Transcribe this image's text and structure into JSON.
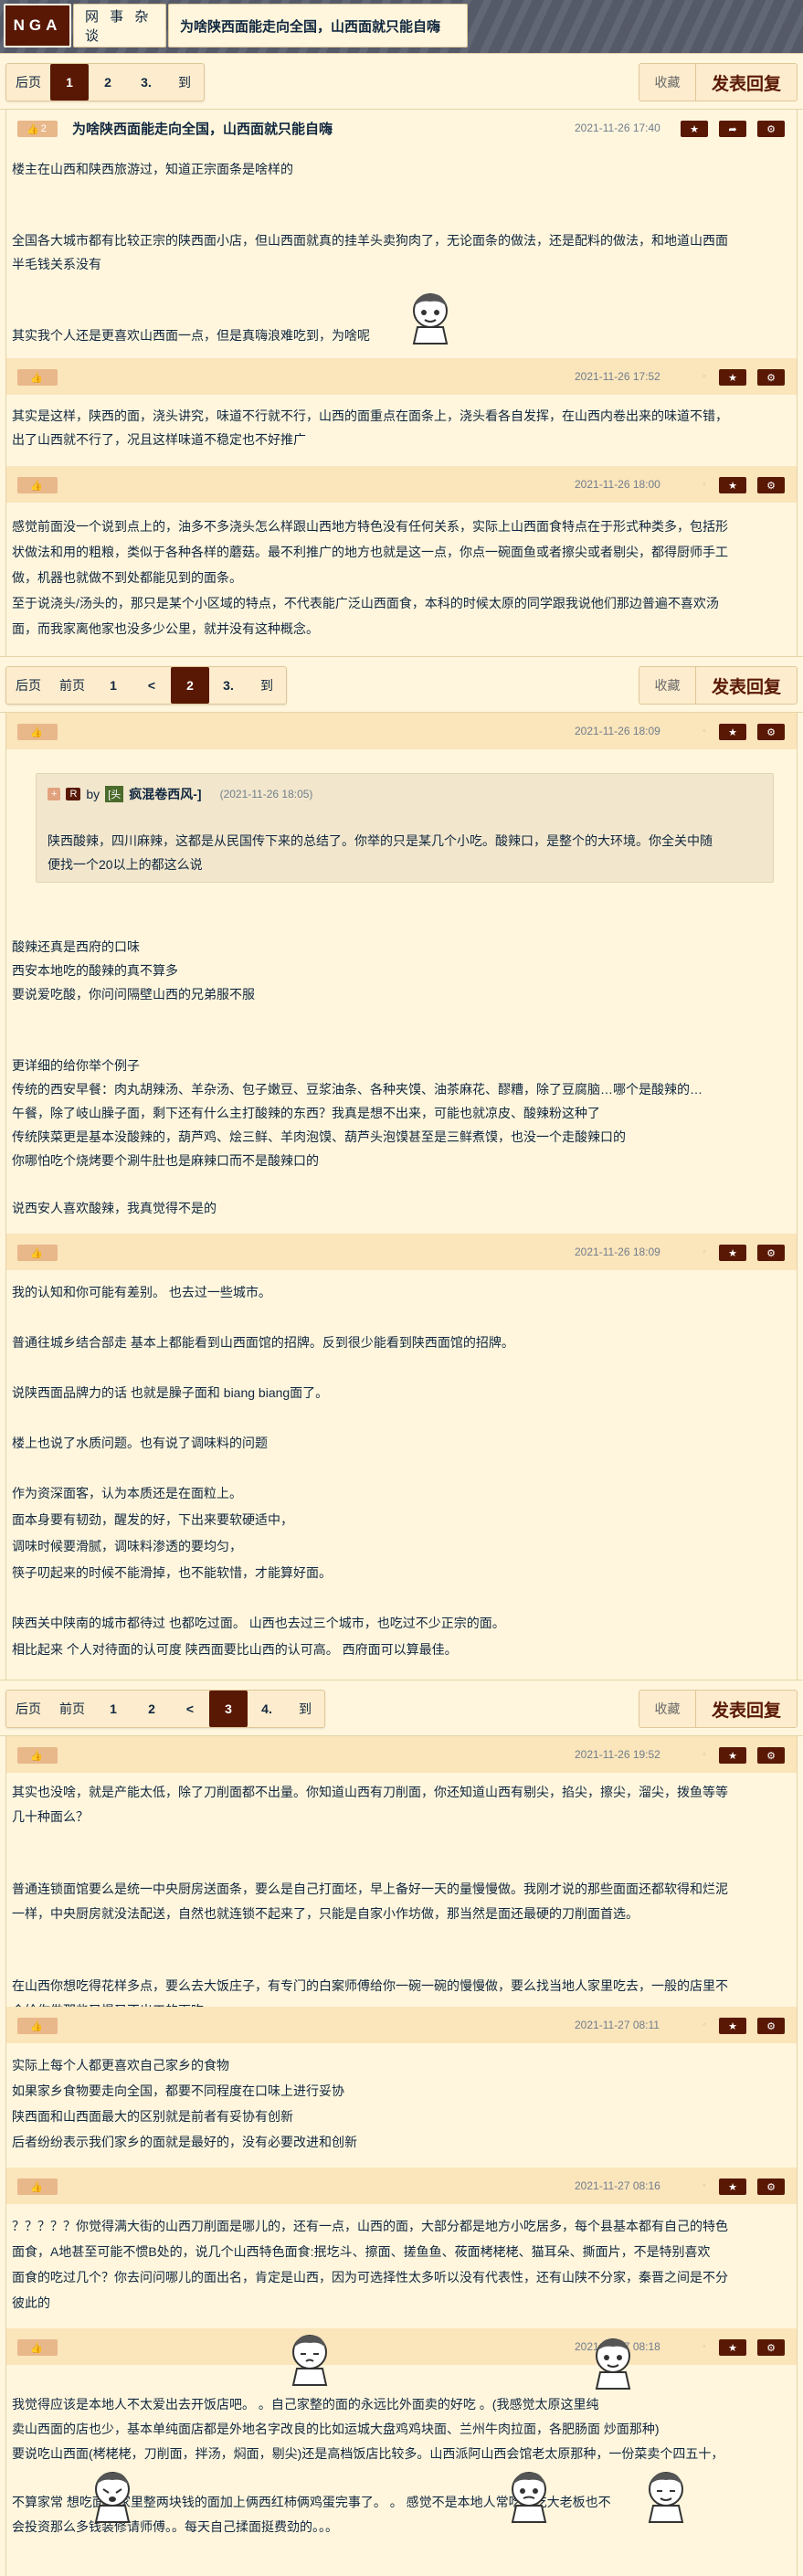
{
  "site": {
    "logo": "NGA",
    "forum": "网 事 杂 谈",
    "thread_title": "为啥陕西面能走向全国，山西面就只能自嗨"
  },
  "colors": {
    "accent": "#591804",
    "background": "#fff6dd",
    "time": "#707d8c"
  },
  "icons": {
    "vote": "thumbs-icon",
    "dot": "lamp-icon",
    "star": "star-icon",
    "share": "share-icon",
    "gear": "gear-icon"
  },
  "pager1": {
    "items": [
      "后页",
      "1",
      "2",
      "3.",
      "到"
    ],
    "current": "1"
  },
  "pager2": {
    "items": [
      "后页",
      "前页",
      "1",
      "<",
      "2",
      "3.",
      "到"
    ],
    "current": "2"
  },
  "pager3": {
    "items": [
      "后页",
      "前页",
      "1",
      "2",
      "<",
      "3",
      "4.",
      "到"
    ],
    "current": "3"
  },
  "actions": {
    "favorite": "收藏",
    "reply": "发表回复"
  },
  "posts": [
    {
      "title": "为啥陕西面能走向全国，山西面就只能自嗨",
      "time": "2021-11-26 17:40",
      "vote": "2",
      "lines": [
        "楼主在山西和陕西旅游过，知道正宗面条是啥样的",
        "",
        "",
        "全国各大城市都有比较正宗的陕西面小店，但山西面就真的挂羊头卖狗肉了，无论面条的做法，还是配料的做法，和地道山西面",
        "半毛钱关系没有",
        "",
        "",
        "其实我个人还是更喜欢山西面一点，但是真嗨浪难吃到，为啥呢"
      ]
    },
    {
      "time": "2021-11-26 17:52",
      "lines": [
        "其实是这样，陕西的面，浇头讲究，味道不行就不行，山西的面重点在面条上，浇头看各自发挥，在山西内卷出来的味道不错，",
        "出了山西就不行了，况且这样味道不稳定也不好推广"
      ]
    },
    {
      "time": "2021-11-26 18:00",
      "lines": [
        "感觉前面没一个说到点上的，油多不多浇头怎么样跟山西地方特色没有任何关系，实际上山西面食特点在于形式种类多，包括形",
        "状做法和用的粗粮，类似于各种各样的蘑菇。最不利推广的地方也就是这一点，你点一碗面鱼或者擦尖或者剔尖，都得厨师手工",
        "做，机器也就做不到处都能见到的面条。",
        "至于说浇头/汤头的，那只是某个小区域的特点，不代表能广泛山西面食，本科的时候太原的同学跟我说他们那边普遍不喜欢汤",
        "面，而我家离他家也没多少公里，就并没有这种概念。"
      ]
    },
    {
      "time": "2021-11-26 18:09",
      "quote": {
        "num": "+",
        "r": "R",
        "by": "by",
        "avatar": "[头",
        "user": "疯混卷西风-]",
        "time": "(2021-11-26 18:05)",
        "lines": [
          "陕西酸辣，四川麻辣，这都是从民国传下来的总结了。你举的只是某几个小吃。酸辣口，是整个的大环境。你全关中随",
          "便找一个20以上的都这么说"
        ]
      },
      "lines": [
        "酸辣还真是西府的口味",
        "西安本地吃的酸辣的真不算多",
        "要说爱吃酸，你问问隔壁山西的兄弟服不服",
        "",
        "",
        "更详细的给你举个例子",
        "传统的西安早餐：肉丸胡辣汤、羊杂汤、包子嫩豆、豆浆油条、各种夹馍、油茶麻花、醪糟，除了豆腐脑…哪个是酸辣的…",
        "午餐，除了岐山臊子面，剩下还有什么主打酸辣的东西？我真是想不出来，可能也就凉皮、酸辣粉这种了",
        "传统陕菜更是基本没酸辣的，葫芦鸡、烩三鲜、羊肉泡馍、葫芦头泡馍甚至是三鲜煮馍，也没一个走酸辣口的",
        "你哪怕吃个烧烤要个涮牛肚也是麻辣口而不是酸辣口的",
        "",
        "说西安人喜欢酸辣，我真觉得不是的"
      ]
    },
    {
      "time": "2021-11-26 18:09",
      "lines": [
        "我的认知和你可能有差别。 也去过一些城市。",
        "",
        "普通往城乡结合部走 基本上都能看到山西面馆的招牌。反到很少能看到陕西面馆的招牌。",
        "",
        "说陕西面品牌力的话 也就是臊子面和 biang biang面了。",
        "",
        "楼上也说了水质问题。也有说了调味料的问题",
        "",
        "作为资深面客，认为本质还是在面粒上。",
        "面本身要有韧劲，醒发的好，下出来要软硬适中，",
        "调味时候要滑腻，调味料渗透的要均匀，",
        "筷子叨起来的时候不能滑掉，也不能软惜，才能算好面。",
        "",
        "陕西关中陕南的城市都待过 也都吃过面。 山西也去过三个城市，也吃过不少正宗的面。",
        "相比起来 个人对待面的认可度 陕西面要比山西的认可高。 西府面可以算最佳。"
      ]
    },
    {
      "time": "2021-11-26 19:52",
      "lines": [
        "其实也没啥，就是产能太低，除了刀削面都不出量。你知道山西有刀削面，你还知道山西有剔尖，掐尖，擦尖，溜尖，拨鱼等等",
        "几十种面么？",
        "",
        "",
        "普通连锁面馆要么是统一中央厨房送面条，要么是自己打面坯，早上备好一天的量慢慢做。我刚才说的那些面面还都软得和烂泥",
        "一样，中央厨房就没法配送，自然也就连锁不起来了，只能是自家小作坊做，那当然是面还最硬的刀削面首选。",
        "",
        "",
        "在山西你想吃得花样多点，要么去大饭庄子，有专门的白案师傅给你一碗一碗的慢慢做，要么找当地人家里吃去，一般的店里不",
        "会给你做那些又慢又不出工的面吃。"
      ]
    },
    {
      "time": "2021-11-27 08:11",
      "lines": [
        "实际上每个人都更喜欢自己家乡的食物",
        "如果家乡食物要走向全国，都要不同程度在口味上进行妥协",
        "陕西面和山西面最大的区别就是前者有妥协有创新",
        "后者纷纷表示我们家乡的面就是最好的，没有必要改进和创新"
      ]
    },
    {
      "time": "2021-11-27 08:16",
      "lines": [
        "？？？？？你觉得满大街的山西刀削面是哪儿的，还有一点，山西的面，大部分都是地方小吃居多，每个县基本都有自己的特色",
        "面食，A地甚至可能不惯B处的，说几个山西特色面食:抿圪斗、擦面、搓鱼鱼、莜面栲栳栳、猫耳朵、撕面片，不是特别喜欢",
        "面食的吃过几个？你去问问哪儿的面出名，肯定是山西，因为可选择性太多听以没有代表性，还有山陕不分家，秦晋之间是不分",
        "彼此的"
      ]
    },
    {
      "time": "2021-11-27 08:18",
      "lines": [
        "",
        "我觉得应该是本地人不太爱出去开饭店吧。                          。自己家整的面的永远比外面卖的好吃                。(我感觉太原这里纯",
        "卖山西面的店也少，基本单纯面店都是外地名字改良的比如运城大盘鸡鸡块面、兰州牛肉拉面，各肥肠面 炒面那种)",
        "要说吃山西面(栲栳栳，刀削面，拌汤，焖面，剔尖)还是高档饭店比较多。山西派阿山西会馆老太原那种，一份菜卖个四五十，",
        "",
        "不算家常                想吃面，家里整两块钱的面加上俩西红柿俩鸡蛋完事了。                        。                 感觉不是本地人常吃爱吃大老板也不",
        "会投资那么多钱装修请师傅。。每天自己揉面挺费劲的。。。"
      ]
    }
  ]
}
